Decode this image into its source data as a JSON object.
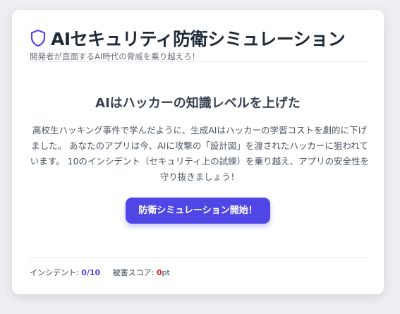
{
  "header": {
    "icon": "shield-icon",
    "title": "AIセキュリティ防衛シミュレーション",
    "subtitle": "開発者が直面するAI時代の脅威を乗り越えろ！"
  },
  "main": {
    "heading": "AIはハッカーの知識レベルを上げた",
    "description": "高校生ハッキング事件で学んだように、生成AIはハッカーの学習コストを劇的に下げました。 あなたのアプリは今、AIに攻撃の「設計図」を渡されたハッカーに狙われています。 10のインシデント（セキュリティ上の試練）を乗り越え、アプリの安全性を守り抜きましょう！",
    "start_button_label": "防衛シミュレーション開始！"
  },
  "footer": {
    "incident_label": "インシデント: ",
    "incident_value": "0/10",
    "score_label": "被害スコア: ",
    "score_value": "0",
    "score_unit": "pt"
  },
  "colors": {
    "accent": "#4f46e5",
    "danger": "#dc2626",
    "title": "#1f2937"
  }
}
